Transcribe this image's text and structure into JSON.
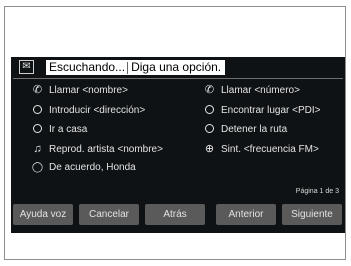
{
  "header": {
    "listening_label": "Escuchando...",
    "prompt": "Diga una opción."
  },
  "commands": [
    {
      "icon": "phone-icon",
      "glyph": "📞",
      "label": "Llamar <nombre>"
    },
    {
      "icon": "phone-icon",
      "glyph": "📞",
      "label": "Llamar <número>"
    },
    {
      "icon": "navigation-icon",
      "glyph": "",
      "label": "Introducir <dirección>"
    },
    {
      "icon": "navigation-icon",
      "glyph": "",
      "label": "Encontrar lugar <PDI>"
    },
    {
      "icon": "navigation-icon",
      "glyph": "",
      "label": "Ir a casa"
    },
    {
      "icon": "navigation-icon",
      "glyph": "",
      "label": "Detener la ruta"
    },
    {
      "icon": "music-note-icon",
      "glyph": "♫",
      "label": "Reprod. artista <nombre>"
    },
    {
      "icon": "radio-icon",
      "glyph": "",
      "label": "Sint. <frecuencia FM>"
    },
    {
      "icon": "voice-icon",
      "glyph": "",
      "label": "De acuerdo, Honda"
    }
  ],
  "pager": "Página 1 de 3",
  "buttons": {
    "help": "Ayuda voz",
    "cancel": "Cancelar",
    "back": "Atrás",
    "previous": "Anterior",
    "next": "Siguiente"
  }
}
